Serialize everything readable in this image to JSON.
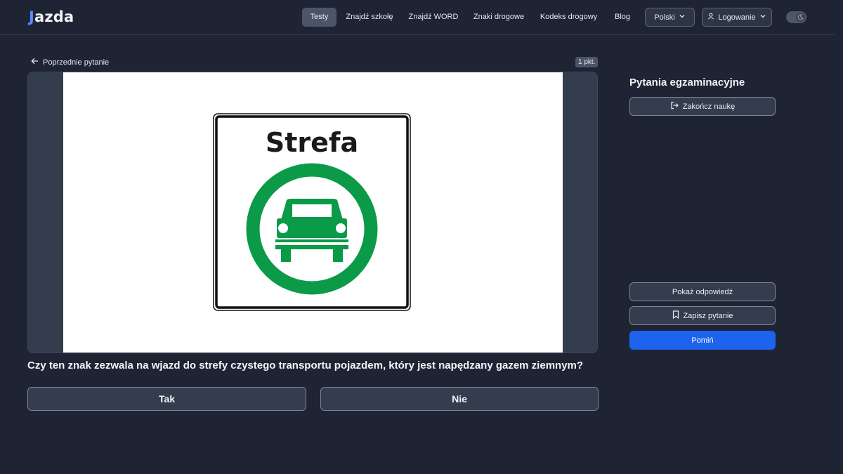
{
  "header": {
    "logo_j": "J",
    "logo_rest": "azda",
    "nav": [
      "Testy",
      "Znajdź szkołę",
      "Znajdź WORD",
      "Znaki drogowe",
      "Kodeks drogowy",
      "Blog"
    ],
    "active_nav": "Testy",
    "language_label": "Polski",
    "login_label": "Logowanie"
  },
  "main": {
    "prev_label": "Poprzednie pytanie",
    "points_badge": "1 pkt.",
    "sign_text": "Strefa",
    "question": "Czy ten znak zezwala na wjazd do strefy czystego transportu pojazdem, który jest napędzany gazem ziemnym?",
    "answers": [
      "Tak",
      "Nie"
    ]
  },
  "sidebar": {
    "title": "Pytania egzaminacyjne",
    "end_label": "Zakończ naukę",
    "show_answer_label": "Pokaż odpowiedź",
    "save_label": "Zapisz pytanie",
    "skip_label": "Pomiń"
  },
  "colors": {
    "background": "#1e2433",
    "accent": "#1d63ed",
    "sign_green": "#0a9a48"
  }
}
